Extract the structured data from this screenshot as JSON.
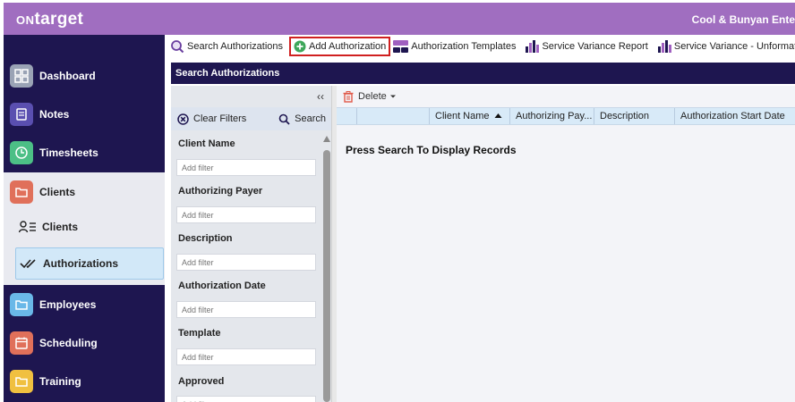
{
  "app": {
    "logo": "target",
    "logo_prefix": "ON",
    "company": "Cool & Bunyan Ente"
  },
  "sidebar": {
    "items": [
      {
        "label": "Dashboard",
        "icon": "dashboard-grid-icon",
        "color": "#9aa3b5"
      },
      {
        "label": "Notes",
        "icon": "notes-icon",
        "color": "#5a4fb0"
      },
      {
        "label": "Timesheets",
        "icon": "clock-icon",
        "color": "#4cbf86"
      },
      {
        "label": "Clients",
        "icon": "folder-icon",
        "color": "#e0705a"
      },
      {
        "label": "Employees",
        "icon": "folder-icon",
        "color": "#6ab8e8"
      },
      {
        "label": "Scheduling",
        "icon": "calendar-icon",
        "color": "#e0705a"
      },
      {
        "label": "Training",
        "icon": "folder-icon",
        "color": "#f0c040"
      }
    ],
    "sub_items": [
      {
        "label": "Clients",
        "icon": "client-list-icon"
      },
      {
        "label": "Authorizations",
        "icon": "double-check-icon",
        "active": true
      }
    ]
  },
  "toolbar": {
    "items": [
      {
        "label": "Search Authorizations",
        "icon": "search-icon"
      },
      {
        "label": "Add Authorization",
        "icon": "add-circle-icon",
        "active": true
      },
      {
        "label": "Authorization Templates",
        "icon": "templates-icon"
      },
      {
        "label": "Service Variance Report",
        "icon": "bar-chart-icon"
      },
      {
        "label": "Service Variance - Unformatt",
        "icon": "bar-chart-icon"
      }
    ]
  },
  "panel": {
    "title": "Search Authorizations"
  },
  "filters": {
    "clear_label": "Clear Filters",
    "search_label": "Search",
    "collapse_glyph": "‹‹",
    "placeholder": "Add filter",
    "fields": [
      "Client Name",
      "Authorizing Payer",
      "Description",
      "Authorization Date",
      "Template",
      "Approved"
    ]
  },
  "results": {
    "delete_label": "Delete",
    "columns": [
      "Client Name",
      "Authorizing Pay...",
      "Description",
      "Authorization Start Date"
    ],
    "empty_message": "Press Search To Display Records"
  },
  "colors": {
    "header": "#a06ec0",
    "sidebar": "#1e1650",
    "accent_red": "#d02020",
    "grid_header": "#d8eaf8"
  }
}
